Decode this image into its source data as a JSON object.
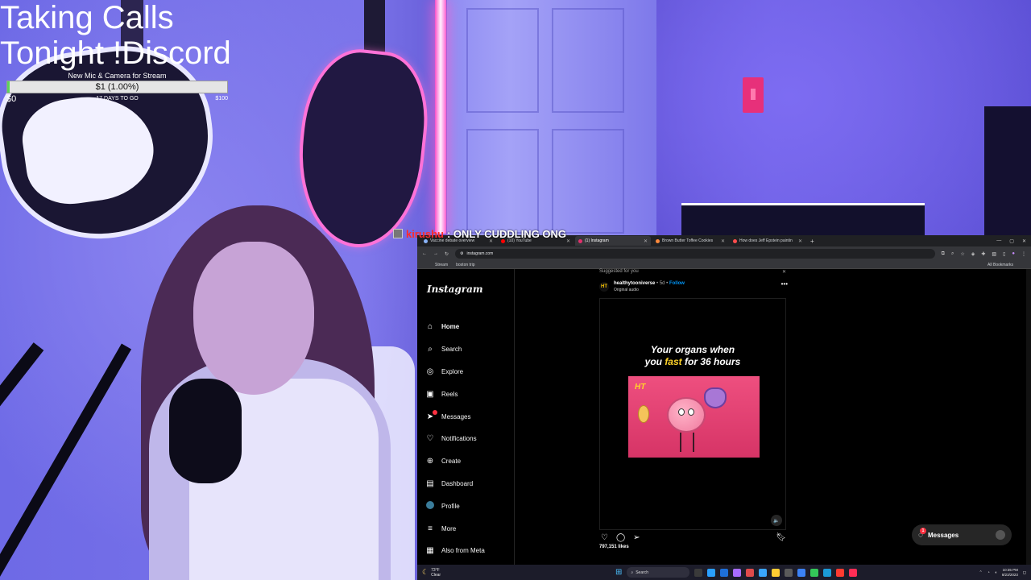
{
  "overlay": {
    "title_line1": "Taking Calls",
    "title_line2": "Tonight !Discord",
    "goal": {
      "label": "New Mic & Camera for Stream",
      "amount": "$1 (1.00%)",
      "progress_percent": 1,
      "min": "$0",
      "days_left": "17 DAYS TO GO",
      "max": "$100"
    },
    "chat": {
      "user": "kirushu",
      "message": ": ONLY CUDDLING ONG"
    }
  },
  "browser": {
    "tabs": [
      {
        "title": "Vaccine debate overview",
        "active": false,
        "icon_color": "#8ab4f8"
      },
      {
        "title": "(10) YouTube",
        "active": false,
        "icon_color": "#ff0000"
      },
      {
        "title": "(1) Instagram",
        "active": true,
        "icon_color": "#e1306c"
      },
      {
        "title": "Brown Butter Toffee Cookies",
        "active": false,
        "icon_color": "#ff8a3d"
      },
      {
        "title": "How does Jeff Epstein paintin",
        "active": false,
        "icon_color": "#ff4d4d"
      }
    ],
    "url": "instagram.com",
    "bookmarks": [
      "Stream",
      "boston trip"
    ],
    "all_bookmarks": "All Bookmarks"
  },
  "instagram": {
    "logo": "Instagram",
    "nav": [
      {
        "label": "Home",
        "icon": "home-icon",
        "glyph": "⌂",
        "active": true
      },
      {
        "label": "Search",
        "icon": "search-icon",
        "glyph": "⌕",
        "active": false
      },
      {
        "label": "Explore",
        "icon": "compass-icon",
        "glyph": "◎",
        "active": false
      },
      {
        "label": "Reels",
        "icon": "reels-icon",
        "glyph": "▣",
        "active": false
      },
      {
        "label": "Messages",
        "icon": "messenger-icon",
        "glyph": "➤",
        "active": false,
        "badge": true
      },
      {
        "label": "Notifications",
        "icon": "heart-icon",
        "glyph": "♡",
        "active": false
      },
      {
        "label": "Create",
        "icon": "create-icon",
        "glyph": "⊕",
        "active": false
      },
      {
        "label": "Dashboard",
        "icon": "dashboard-icon",
        "glyph": "▤",
        "active": false
      },
      {
        "label": "Profile",
        "icon": "avatar-icon",
        "glyph": "",
        "active": false
      },
      {
        "label": "More",
        "icon": "menu-icon",
        "glyph": "≡",
        "active": false
      },
      {
        "label": "Also from Meta",
        "icon": "meta-icon",
        "glyph": "▦",
        "active": false
      }
    ],
    "post": {
      "suggested": "Suggested for you",
      "username": "healthytooniverse",
      "time": "5d",
      "follow": "Follow",
      "audio": "Original audio",
      "caption_line1": "Your organs when",
      "caption_line2_pre": "you ",
      "caption_line2_hl": "fast",
      "caption_line2_post": " for 36 hours",
      "likes": "797,151 likes"
    },
    "messages_pill": {
      "label": "Messages",
      "badge": "1"
    }
  },
  "taskbar": {
    "weather_temp": "73°F",
    "weather_desc": "Clear",
    "search": "Search",
    "time": "10:35 PM",
    "date": "8/23/2023",
    "apps": [
      "#3a3a3a",
      "#2aa0ff",
      "#1e6fd9",
      "#a86cff",
      "#e04b4b",
      "#3aa6ff",
      "#ffcc33",
      "#5a5a5a",
      "#3b82f6",
      "#34c759",
      "#1b9bd7",
      "#ff3b30",
      "#ff2d55"
    ]
  }
}
